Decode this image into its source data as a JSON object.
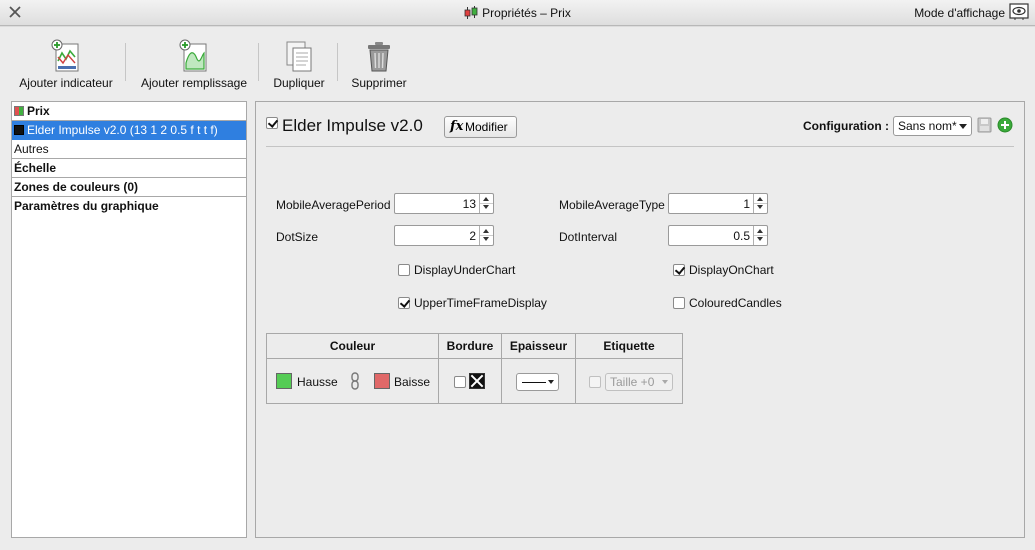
{
  "window": {
    "title": "Propriétés – Prix",
    "view_mode_label": "Mode d'affichage",
    "icons": {
      "close": "close-icon",
      "title": "candlestick-icon",
      "view_mode": "eye-icon"
    }
  },
  "toolbar": {
    "items": [
      {
        "label": "Ajouter indicateur",
        "icon": "add-indicator-icon"
      },
      {
        "label": "Ajouter remplissage",
        "icon": "add-fill-icon"
      },
      {
        "label": "Dupliquer",
        "icon": "duplicate-icon"
      },
      {
        "label": "Supprimer",
        "icon": "trash-icon"
      }
    ]
  },
  "tree": {
    "items": [
      {
        "label": "Prix",
        "bold": true,
        "swatch": [
          "#e05050",
          "#40b040"
        ]
      },
      {
        "label": "Elder Impulse v2.0 (13 1 2 0.5 f t t f)",
        "selected": true,
        "swatch": [
          "#111111"
        ]
      },
      {
        "label": "Autres",
        "bold": false
      },
      {
        "label": "Échelle",
        "bold": true
      },
      {
        "label": "Zones de couleurs (0)",
        "bold": true
      },
      {
        "label": "Paramètres du graphique",
        "bold": true
      }
    ]
  },
  "indicator": {
    "enabled": true,
    "name": "Elder Impulse v2.0",
    "modify_label": "Modifier",
    "modify_icon": "fx-icon"
  },
  "configuration": {
    "label": "Configuration :",
    "selected": "Sans nom*",
    "save_icon": "save-icon",
    "add_icon": "add-icon"
  },
  "params": {
    "mobile_average_period": {
      "label": "MobileAveragePeriod",
      "value": "13"
    },
    "mobile_average_type": {
      "label": "MobileAverageType",
      "value": "1"
    },
    "dot_size": {
      "label": "DotSize",
      "value": "2"
    },
    "dot_interval": {
      "label": "DotInterval",
      "value": "0.5"
    },
    "display_under_chart": {
      "label": "DisplayUnderChart",
      "checked": false
    },
    "display_on_chart": {
      "label": "DisplayOnChart",
      "checked": true
    },
    "upper_time_frame_display": {
      "label": "UpperTimeFrameDisplay",
      "checked": true
    },
    "coloured_candles": {
      "label": "ColouredCandles",
      "checked": false
    }
  },
  "color_table": {
    "headers": {
      "couleur": "Couleur",
      "bordure": "Bordure",
      "epaisseur": "Epaisseur",
      "etiquette": "Etiquette"
    },
    "up": {
      "label": "Hausse",
      "color": "#55cc55"
    },
    "down": {
      "label": "Baisse",
      "color": "#e06868"
    },
    "link_icon": "chain-link-icon",
    "border_checked": false,
    "label_checked": false,
    "label_size": "Taille +0"
  }
}
